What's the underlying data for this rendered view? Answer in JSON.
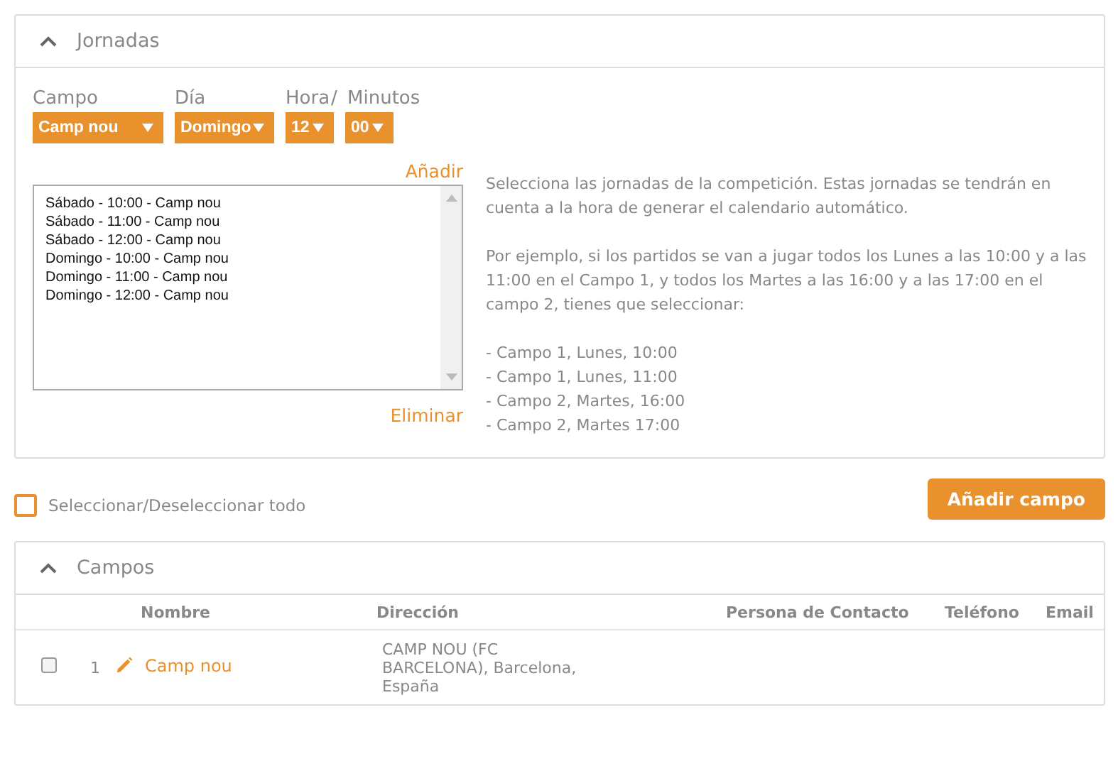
{
  "jornadas_panel": {
    "title": "Jornadas",
    "expanded": true,
    "selects": [
      {
        "label": "Campo",
        "value": "Camp nou"
      },
      {
        "label": "Día",
        "value": "Domingo"
      },
      {
        "label": "Hora",
        "value": "12"
      },
      {
        "separator": "/",
        "label": "Minutos",
        "value": "00"
      }
    ],
    "add_link": "Añadir",
    "jornadas_list": [
      "Sábado - 10:00 - Camp nou",
      "Sábado - 11:00 - Camp nou",
      "Sábado - 12:00 - Camp nou",
      "Domingo - 10:00 - Camp nou",
      "Domingo - 11:00 - Camp nou",
      "Domingo - 12:00 - Camp nou"
    ],
    "remove_link": "Eliminar",
    "help_paragraphs": [
      "Selecciona las jornadas de la competición. Estas jornadas se tendrán en cuenta a la hora de generar el calendario automático.",
      "Por ejemplo, si los partidos se van a jugar todos los Lunes a las 10:00 y a las 11:00 en el Campo 1, y todos los Martes a las 16:00 y a las 17:00 en el campo 2, tienes que seleccionar:"
    ],
    "help_examples": [
      "- Campo 1, Lunes, 10:00",
      "- Campo 1, Lunes, 11:00",
      "- Campo 2, Martes, 16:00",
      "- Campo 2, Martes 17:00"
    ]
  },
  "select_all": {
    "label": "Seleccionar/Deseleccionar todo",
    "checked": false
  },
  "add_field_button": "Añadir campo",
  "campos_panel": {
    "title": "Campos",
    "expanded": true,
    "columns": [
      "Nombre",
      "Dirección",
      "Persona de Contacto",
      "Teléfono",
      "Email"
    ],
    "rows": [
      {
        "checked": false,
        "number": "1",
        "name": "Camp nou",
        "address": "CAMP NOU (FC BARCELONA), Barcelona, España"
      }
    ]
  }
}
